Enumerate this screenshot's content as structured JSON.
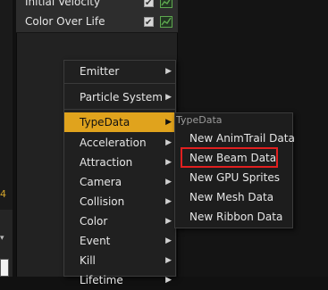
{
  "modules": [
    {
      "label": "Initial Velocity"
    },
    {
      "label": "Color Over Life"
    }
  ],
  "left_marker": "4",
  "context_menu": {
    "items": [
      {
        "label": "Emitter",
        "has_submenu": true
      },
      {
        "label": "Particle System",
        "has_submenu": true
      },
      {
        "label": "TypeData",
        "has_submenu": true,
        "active": true
      },
      {
        "label": "Acceleration",
        "has_submenu": true
      },
      {
        "label": "Attraction",
        "has_submenu": true
      },
      {
        "label": "Camera",
        "has_submenu": true
      },
      {
        "label": "Collision",
        "has_submenu": true
      },
      {
        "label": "Color",
        "has_submenu": true
      },
      {
        "label": "Event",
        "has_submenu": true
      },
      {
        "label": "Kill",
        "has_submenu": true
      },
      {
        "label": "Lifetime",
        "has_submenu": true
      }
    ]
  },
  "submenu": {
    "header": "TypeData",
    "items": [
      {
        "label": "New AnimTrail Data"
      },
      {
        "label": "New Beam Data",
        "highlighted": true
      },
      {
        "label": "New GPU Sprites"
      },
      {
        "label": "New Mesh Data"
      },
      {
        "label": "New Ribbon Data"
      }
    ]
  },
  "colors": {
    "active_item": "#e0a31d",
    "highlight_box": "#e02020",
    "curve_icon": "#5ea84f"
  },
  "icons": {
    "checkbox": "checkbox-checked-icon",
    "curve": "curve-graph-icon",
    "submenu_arrow": "chevron-right-icon"
  }
}
